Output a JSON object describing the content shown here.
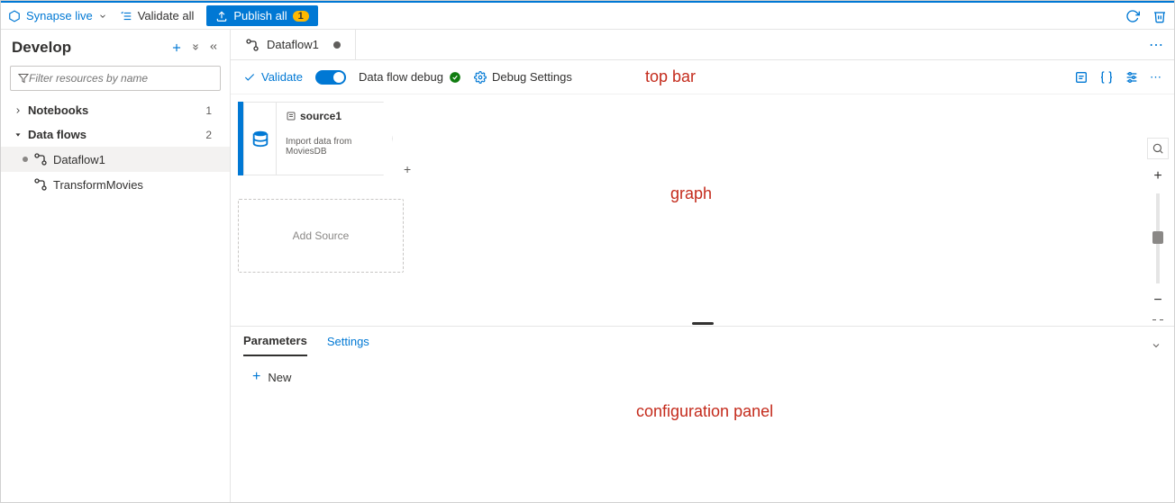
{
  "cmdbar": {
    "synapse_live": "Synapse live",
    "validate_all": "Validate all",
    "publish_all": "Publish all",
    "publish_count": "1"
  },
  "sidebar": {
    "title": "Develop",
    "filter_placeholder": "Filter resources by name",
    "groups": [
      {
        "label": "Notebooks",
        "count": "1",
        "expanded": false
      },
      {
        "label": "Data flows",
        "count": "2",
        "expanded": true
      }
    ],
    "dataflow_items": [
      {
        "label": "Dataflow1",
        "active": true,
        "modified": true
      },
      {
        "label": "TransformMovies",
        "active": false,
        "modified": false
      }
    ]
  },
  "tab": {
    "label": "Dataflow1"
  },
  "actionbar": {
    "validate": "Validate",
    "dfdebug": "Data flow debug",
    "debug_settings": "Debug Settings"
  },
  "canvas": {
    "node": {
      "title": "source1",
      "desc": "Import data from MoviesDB"
    },
    "add_source": "Add Source"
  },
  "config": {
    "tabs": [
      {
        "label": "Parameters",
        "active": true
      },
      {
        "label": "Settings",
        "active": false
      }
    ],
    "new_label": "New"
  },
  "annotations": {
    "topbar": "top bar",
    "graph": "graph",
    "configpanel": "configuration panel"
  }
}
